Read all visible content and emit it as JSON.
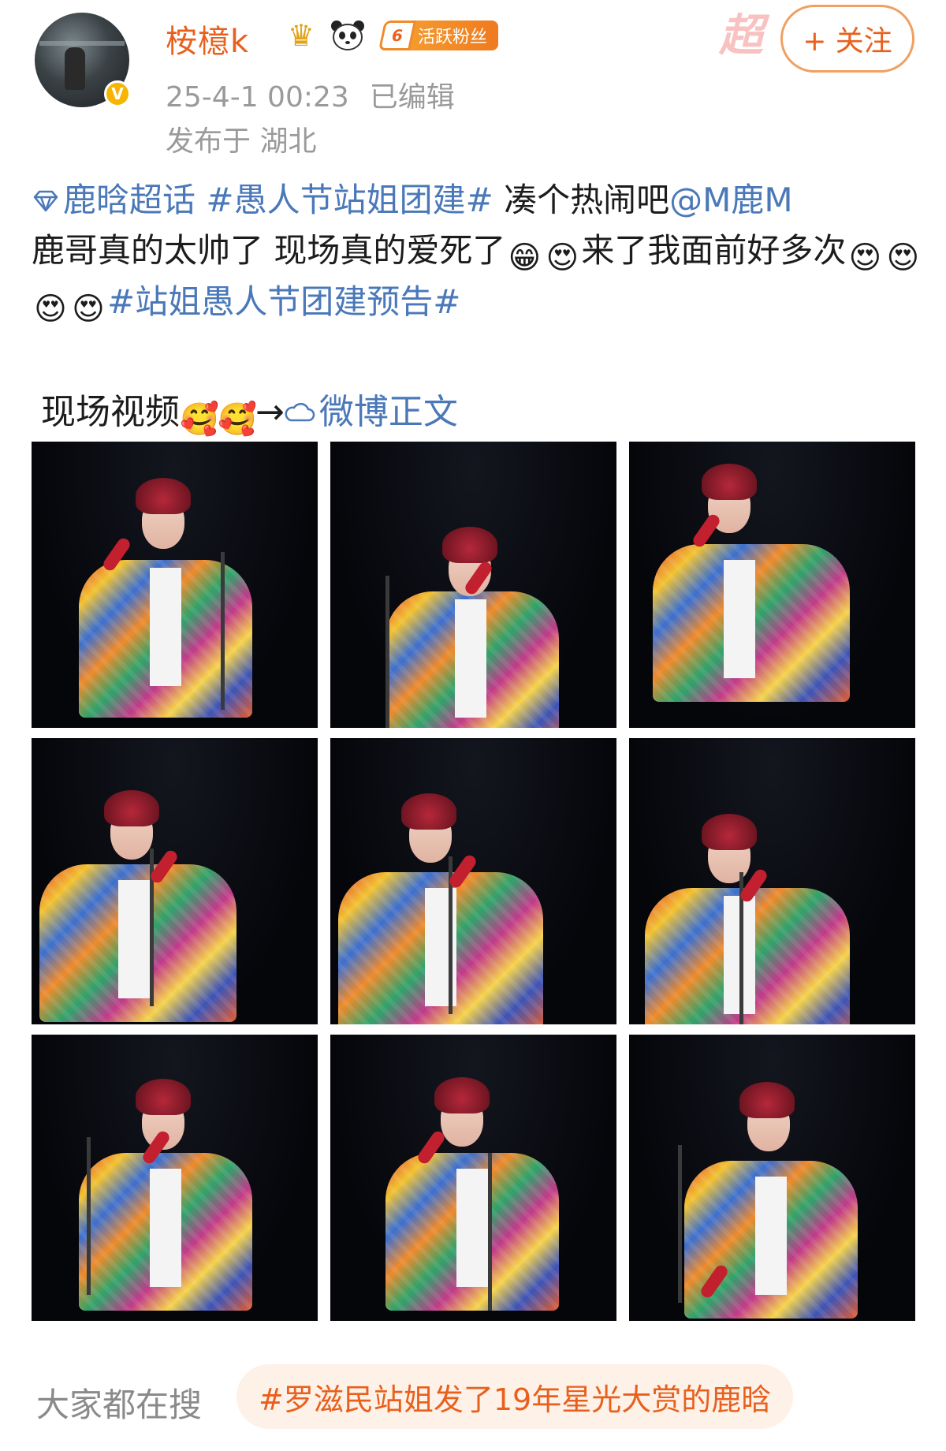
{
  "header": {
    "username": "桉檍k",
    "fan_badge_level": "6",
    "fan_badge_label": "活跃粉丝",
    "follow_label": "+ 关注",
    "date": "25-4-1 00:23",
    "edited": "已编辑",
    "location": "发布于 湖北",
    "watermark": "超"
  },
  "post": {
    "topic_link": "鹿晗超话",
    "hashtag1": "#愚人节站姐团建#",
    "text1": " 凑个热闹吧",
    "mention": "@M鹿M",
    "text2": "鹿哥真的太帅了 现场真的爱死了",
    "text3": "来了我面前好多次",
    "hashtag2": "#站姐愚人节团建预告#",
    "video_text": "现场视频",
    "arrow": "→",
    "weibo_link": "微博正文"
  },
  "icons": {
    "crown": "crown-badge-icon",
    "panda": "panda-badge-icon",
    "verified": "verified-v-icon",
    "topic": "diamond-topic-icon",
    "weibo": "weibo-link-icon",
    "grin": "grinning-emoji",
    "tongue": "heart-eyes-tongue-emoji",
    "heart_eyes": "heart-eyes-emoji",
    "flushed": "flushed-love-emoji"
  },
  "photos_count_label": "",
  "footer": {
    "search_label": "大家都在搜",
    "search_chip": "#罗滋民站姐发了19年星光大赏的鹿晗"
  },
  "colors": {
    "accent_orange": "#e8601c",
    "link_blue": "#4a78b8",
    "meta_gray": "#9a9a9a",
    "chip_bg": "#fdf1e8"
  }
}
